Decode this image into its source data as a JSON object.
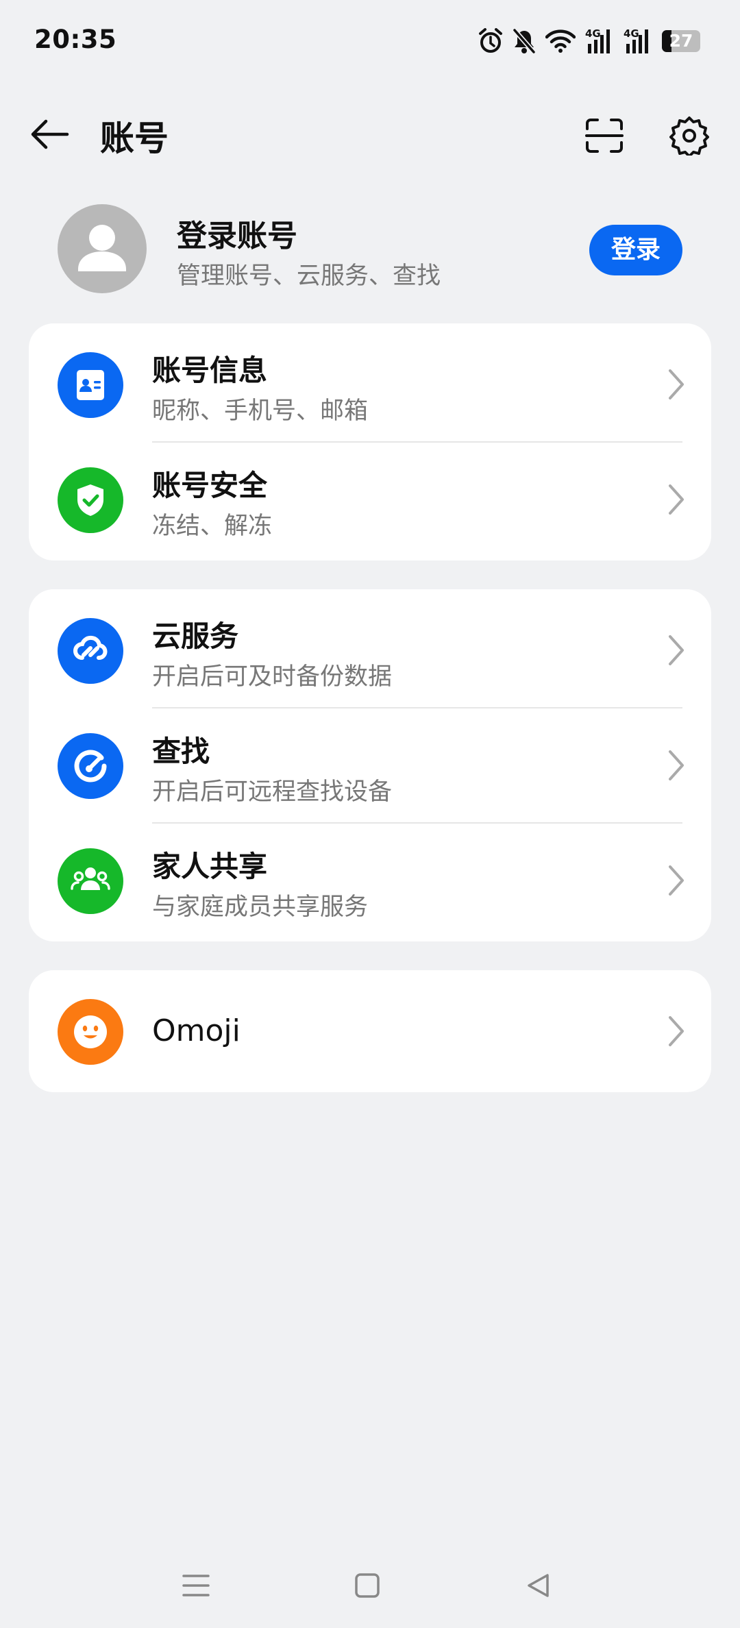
{
  "status_bar": {
    "time": "20:35",
    "signal1_label": "4G",
    "signal2_label": "4G",
    "battery_level": "27"
  },
  "header": {
    "title": "账号",
    "icons": [
      "back-arrow-icon",
      "scan-icon",
      "gear-icon"
    ]
  },
  "profile": {
    "title": "登录账号",
    "subtitle": "管理账号、云服务、查找",
    "login_label": "登录"
  },
  "groups": [
    {
      "items": [
        {
          "title": "账号信息",
          "subtitle": "昵称、手机号、邮箱",
          "icon": "id-card-icon",
          "color": "#0a68f2"
        },
        {
          "title": "账号安全",
          "subtitle": "冻结、解冻",
          "icon": "shield-check-icon",
          "color": "#16b82a"
        }
      ]
    },
    {
      "items": [
        {
          "title": "云服务",
          "subtitle": "开启后可及时备份数据",
          "icon": "cloud-link-icon",
          "color": "#0a68f2"
        },
        {
          "title": "查找",
          "subtitle": "开启后可远程查找设备",
          "icon": "radar-icon",
          "color": "#0a68f2"
        },
        {
          "title": "家人共享",
          "subtitle": "与家庭成员共享服务",
          "icon": "family-icon",
          "color": "#16b82a"
        }
      ]
    },
    {
      "items": [
        {
          "title": "Omoji",
          "icon": "smiley-icon",
          "color": "#fb7a12"
        }
      ]
    }
  ],
  "nav": {
    "icons": [
      "menu-icon",
      "home-square-icon",
      "back-triangle-icon"
    ]
  }
}
